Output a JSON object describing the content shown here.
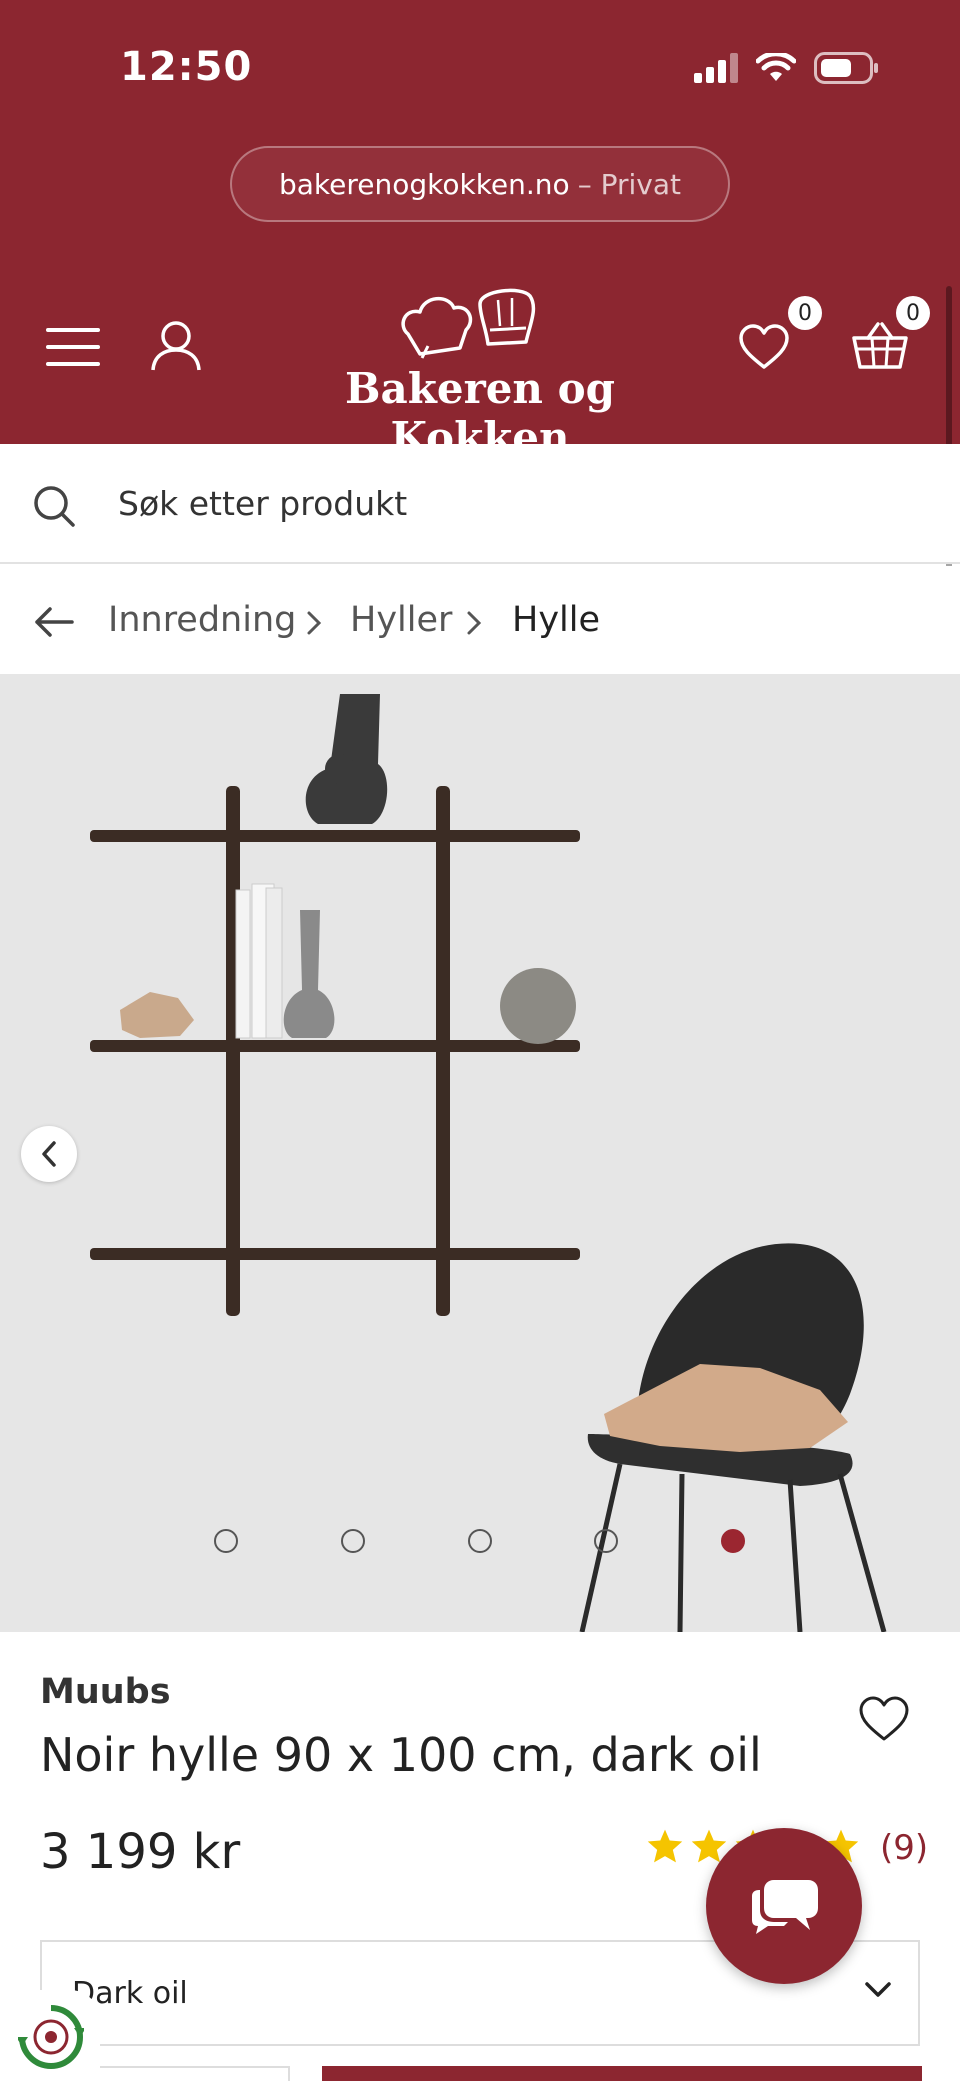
{
  "status_bar": {
    "time": "12:50"
  },
  "browser": {
    "domain": "bakerenogkokken.no",
    "mode": "– Privat"
  },
  "header": {
    "logo_text": "Bakeren og Kokken",
    "wishlist_count": "0",
    "cart_count": "0"
  },
  "search": {
    "placeholder": "Søk etter produkt"
  },
  "breadcrumb": {
    "items": [
      "Innredning",
      "Hyller",
      "Hylle"
    ]
  },
  "gallery": {
    "total_slides": 5,
    "active_slide": 5
  },
  "product": {
    "brand": "Muubs",
    "title": "Noir hylle 90 x 100 cm, dark oil",
    "price": "3 199 kr",
    "rating": 5,
    "review_count": "(9)",
    "variant": "Dark oil"
  },
  "colors": {
    "brand": "#8c2630",
    "star": "#f5c400"
  }
}
